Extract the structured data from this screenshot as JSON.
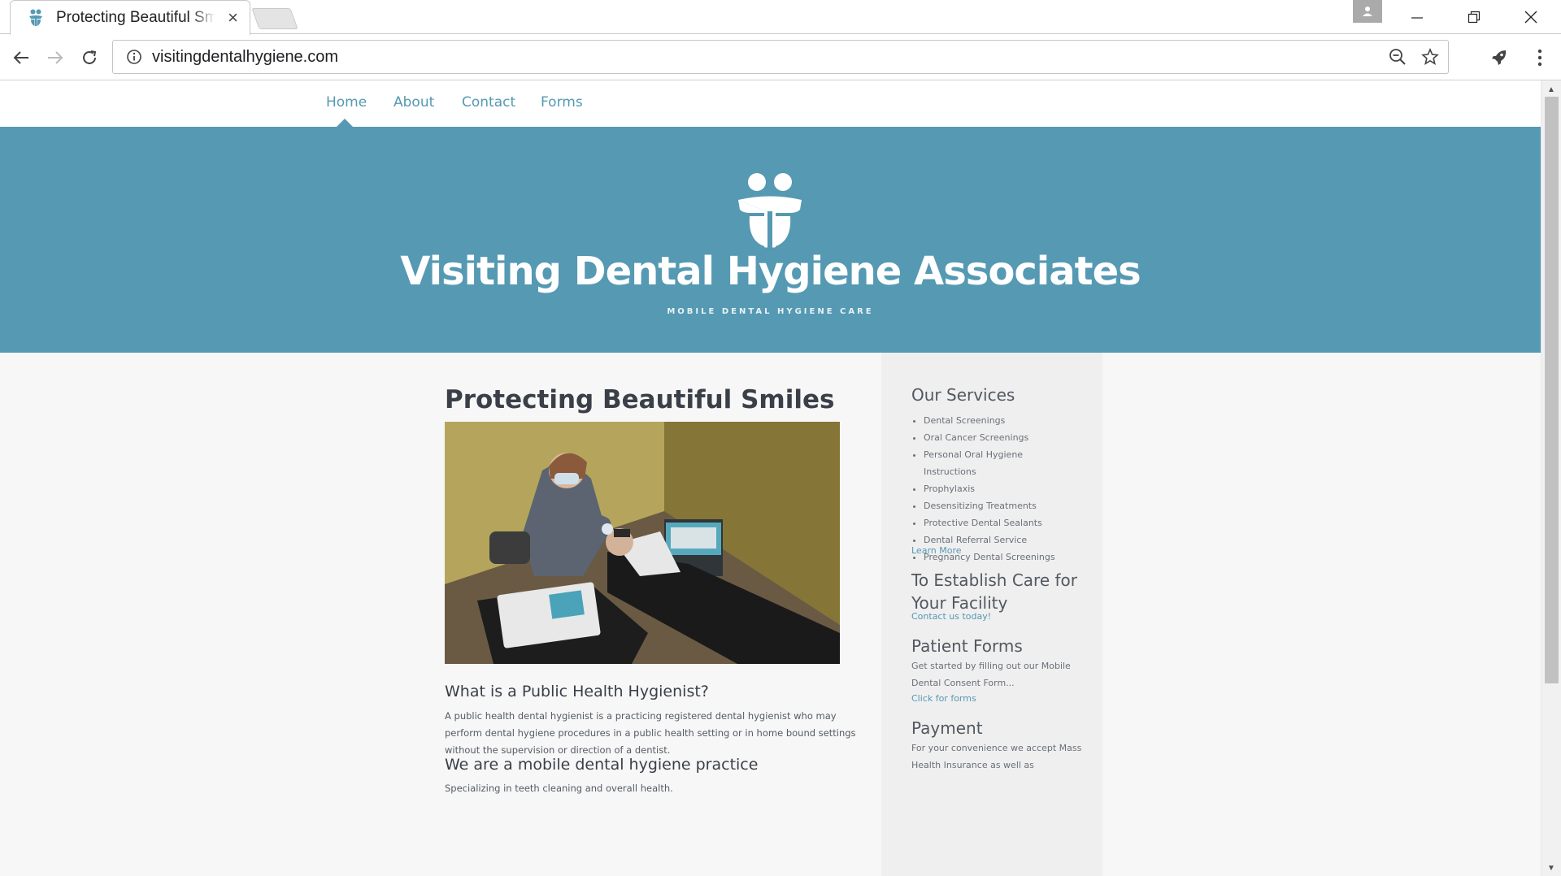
{
  "browser": {
    "tab_title": "Protecting Beautiful Smiles",
    "url": "visitingdentalhygiene.com"
  },
  "nav": {
    "home": "Home",
    "about": "About",
    "contact": "Contact",
    "forms": "Forms",
    "active": "Home"
  },
  "hero": {
    "title": "Visiting Dental Hygiene Associates",
    "tagline": "MOBILE DENTAL HYGIENE CARE"
  },
  "main": {
    "heading": "Protecting Beautiful Smiles",
    "q1_title": "What is a Public Health Hygienist?",
    "q1_text": "A public health dental hygienist is a practicing registered dental hygienist who may perform dental hygiene procedures in a public health setting or in home bound settings without the supervision or direction of a dentist.",
    "q2_title": "We are a mobile dental hygiene practice",
    "q2_text": "Specializing in teeth cleaning and overall health."
  },
  "sidebar": {
    "services_title": "Our Services",
    "services": [
      "Dental Screenings",
      "Oral Cancer Screenings",
      "Personal Oral Hygiene Instructions",
      "Prophylaxis",
      "Desensitizing Treatments",
      "Protective Dental Sealants",
      "Dental Referral Service",
      "Pregnancy Dental Screenings"
    ],
    "learn_more": "Learn More",
    "establish_title": "To Establish Care for Your Facility",
    "contact_link": "Contact us today!",
    "forms_title": "Patient Forms",
    "forms_text": "Get started by filling out our Mobile Dental Consent Form...",
    "forms_link": "Click for forms",
    "payment_title": "Payment",
    "payment_text": "For your convenience we accept Mass Health Insurance as well as"
  },
  "colors": {
    "brand": "#5599b3",
    "text": "#3a3f48"
  }
}
